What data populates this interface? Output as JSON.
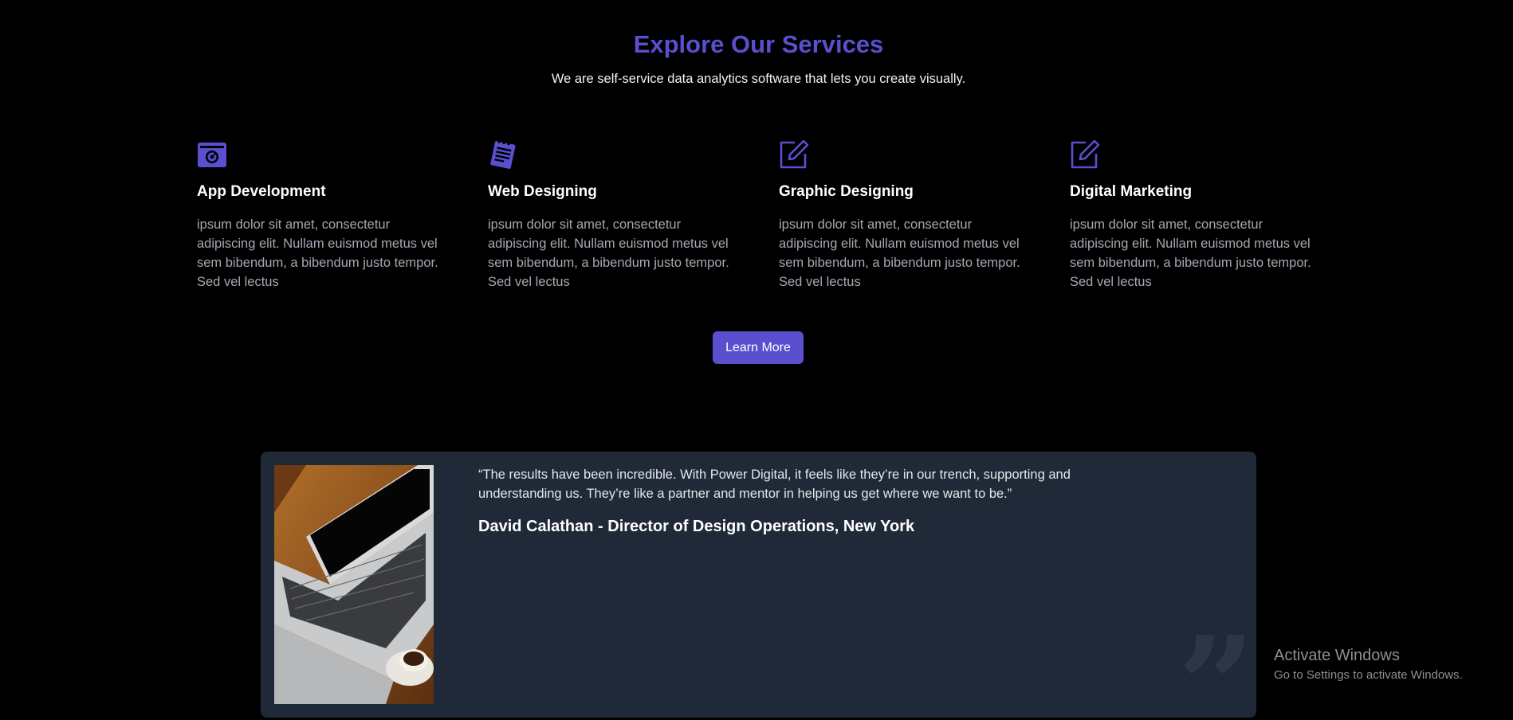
{
  "services_section": {
    "title": "Explore Our Services",
    "subtitle": "We are self-service data analytics software that lets you create visually.",
    "accent_color": "#5a4fcf",
    "items": [
      {
        "icon": "camera-icon",
        "title": "App Development",
        "description": "ipsum dolor sit amet, consectetur adipiscing elit. Nullam euismod metus vel sem bibendum, a bibendum justo tempor. Sed vel lectus"
      },
      {
        "icon": "notepad-icon",
        "title": "Web Designing",
        "description": "ipsum dolor sit amet, consectetur adipiscing elit. Nullam euismod metus vel sem bibendum, a bibendum justo tempor. Sed vel lectus"
      },
      {
        "icon": "edit-icon",
        "title": "Graphic Designing",
        "description": "ipsum dolor sit amet, consectetur adipiscing elit. Nullam euismod metus vel sem bibendum, a bibendum justo tempor. Sed vel lectus"
      },
      {
        "icon": "edit-icon",
        "title": "Digital Marketing",
        "description": "ipsum dolor sit amet, consectetur adipiscing elit. Nullam euismod metus vel sem bibendum, a bibendum justo tempor. Sed vel lectus"
      }
    ],
    "button_label": "Learn More"
  },
  "testimonial": {
    "quote": "“The results have been incredible. With Power Digital, it feels like they’re in our trench, supporting and understanding us. They’re like a partner and mentor in helping us get where we want to be.”",
    "author": "David Calathan - Director of Design Operations, New York",
    "image": "laptop-on-table-photo",
    "quote_mark": "”",
    "background_color": "#1f2937"
  },
  "windows_watermark": {
    "title": "Activate Windows",
    "subtitle": "Go to Settings to activate Windows."
  }
}
